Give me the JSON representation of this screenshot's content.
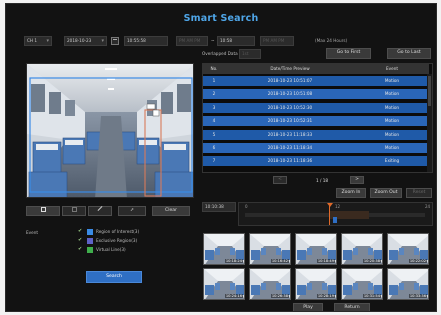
{
  "window": {
    "title": "Smart Search"
  },
  "toolbar": {
    "channel": "CH 1",
    "start_date": "2018-10-23",
    "start_time": "10:55:58",
    "start_ms": "PM  AM  PM",
    "range_sep": "~",
    "end_time": "10:58",
    "end_ms": "PM  AM  PM",
    "max_hint": "(Max 24 Hours)"
  },
  "overlap": {
    "label": "Overlapped Data",
    "value": "1st"
  },
  "nav": {
    "first": "Go to First",
    "last": "Go to Last"
  },
  "table": {
    "headers": [
      "No.",
      "Date/Time Preview",
      "Event"
    ],
    "rows": [
      {
        "no": "1",
        "time": "2018-10-23 10:51:07",
        "event": "Motion"
      },
      {
        "no": "2",
        "time": "2018-10-23 10:51:08",
        "event": "Motion"
      },
      {
        "no": "3",
        "time": "2018-10-23 10:52:30",
        "event": "Motion"
      },
      {
        "no": "4",
        "time": "2018-10-23 10:52:31",
        "event": "Motion"
      },
      {
        "no": "5",
        "time": "2018-10-23 11:18:33",
        "event": "Motion"
      },
      {
        "no": "6",
        "time": "2018-10-23 11:18:34",
        "event": "Motion"
      },
      {
        "no": "7",
        "time": "2018-10-23 11:18:36",
        "event": "Exiting"
      }
    ]
  },
  "pager": {
    "prev": "<",
    "text": "1 / 18",
    "next": ">"
  },
  "zoom": {
    "in": "Zoom In",
    "out": "Zoom Out",
    "fit": "Reset"
  },
  "timeline": {
    "time_value": "10:10:38",
    "ticks": [
      "0",
      "",
      "12",
      "",
      "24"
    ]
  },
  "tools": {
    "clear": "Clear"
  },
  "event_options": {
    "label": "Event",
    "items": [
      {
        "label": "Region of Interest(3)",
        "color": "#3a8be6"
      },
      {
        "label": "Exclusive Region(3)",
        "color": "#5e62c8"
      },
      {
        "label": "Virtual Line(3)",
        "color": "#3fae4c"
      }
    ]
  },
  "search_button": "Search",
  "thumbnails": [
    {
      "time": "10:18:24"
    },
    {
      "time": "10:16:42"
    },
    {
      "time": "10:18:49"
    },
    {
      "time": "10:20:38"
    },
    {
      "time": "10:22:02"
    },
    {
      "time": "10:24:16"
    },
    {
      "time": "10:26:38"
    },
    {
      "time": "10:28:19"
    },
    {
      "time": "10:31:54"
    },
    {
      "time": "10:33:36"
    }
  ],
  "footer": {
    "play": "Play",
    "return": "Return"
  },
  "colors": {
    "accent": "#4fa6e8",
    "selected_row": "#1f5aa8",
    "roi": "#3a8be6",
    "exclusive": "#5e62c8",
    "vline": "#3fae4c"
  }
}
